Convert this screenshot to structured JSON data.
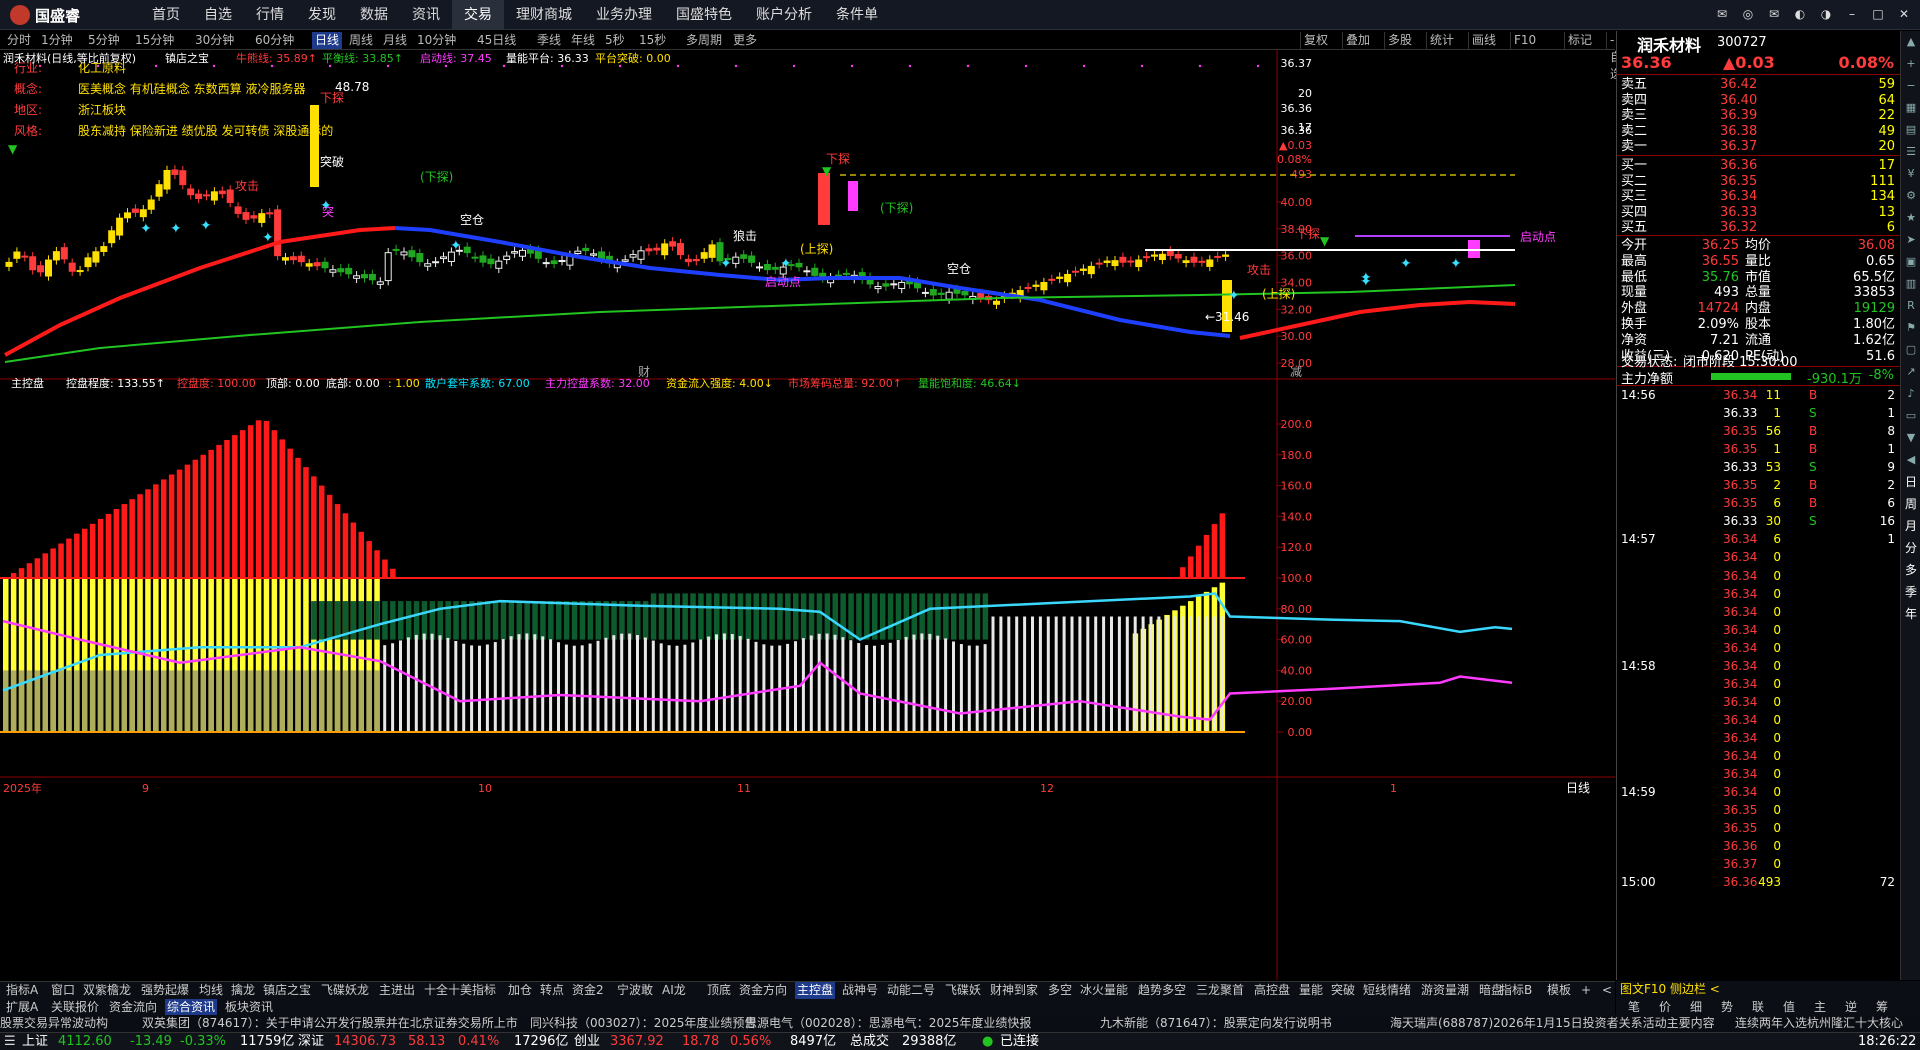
{
  "top": {
    "logo": "国盛睿",
    "menu": [
      "首页",
      "自选",
      "行情",
      "发现",
      "数据",
      "资讯",
      "交易",
      "理财商城",
      "业务办理",
      "国盛特色",
      "账户分析",
      "条件单"
    ],
    "active": "交易"
  },
  "periods": {
    "items": [
      "分时",
      "1分钟",
      "5分钟",
      "15分钟",
      "30分钟",
      "60分钟",
      "日线",
      "周线",
      "月线",
      "10分钟",
      "45日线",
      "季线",
      "年线",
      "5秒",
      "15秒",
      "多周期",
      "更多"
    ],
    "active": "日线",
    "right": [
      "复权",
      "叠加",
      "多股",
      "统计",
      "画线",
      "F10",
      "标记",
      "-自选",
      "返回"
    ]
  },
  "kline": {
    "title": "润禾材料(日线,等比前复权)",
    "indname": "镇店之宝",
    "niuxiong_label": "牛熊线: 35.89↑",
    "pingheng_label": "平衡线: 33.85↑",
    "qidong_label": "启动线: 37.45",
    "liangneng_label": "量能平台: 36.33",
    "tupo_label": "平台突破: 0.00",
    "ylabels": [
      "40.00",
      "38.00",
      "36.00",
      "34.00",
      "32.00",
      "30.00",
      "28.00"
    ],
    "ytop": [
      "36.37",
      "20",
      "36.36",
      "17",
      "36.36",
      "▲0.03",
      "0.08%",
      "493"
    ],
    "info_keys": [
      "行业:",
      "概念:",
      "地区:",
      "风格:"
    ],
    "info_vals": [
      "化工原料",
      "医美概念 有机硅概念 东数西算 液冷服务器",
      "浙江板块",
      "股东减持 保险新进 绩优股 发可转债 深股通标的"
    ],
    "marks": [
      "48.78",
      "下探",
      "突破",
      "攻击",
      "突",
      "(下探)",
      "空仓",
      "下探",
      "(上探)",
      "(下探)",
      "狼击",
      "启动点",
      "←31.46",
      "下探",
      "启动点",
      "攻击",
      "(上探)",
      "空仓",
      "财",
      "减"
    ]
  },
  "sub": {
    "name": "主控盘",
    "ctrl_label": "控盘程度: 133.55↑",
    "kongpan_label": "控盘度: 100.00",
    "ding_label": "顶部: 0.00",
    "di_label": "底部: 0.00",
    "ratio_label": ": 1.00",
    "sanhu_label": "散户套牢系数: 67.00",
    "zhuli_label": "主力控盘系数: 32.00",
    "zijin_label": "资金流入强度: 4.00↓",
    "shichang_label": "市场筹码总量: 92.00↑",
    "liang_label": "量能饱和度: 46.64↓",
    "ylabels": [
      "200.0",
      "180.0",
      "160.0",
      "140.0",
      "120.0",
      "100.0",
      "80.00",
      "60.00",
      "40.00",
      "20.00",
      "0.00"
    ]
  },
  "xaxis": {
    "labels": [
      "2025年",
      "9",
      "10",
      "11",
      "12",
      "1"
    ],
    "right": "日线"
  },
  "quote": {
    "name": "润禾材料",
    "code": "300727",
    "price": "36.36",
    "change": "▲0.03",
    "pct": "0.08%",
    "asks": [
      [
        "卖五",
        "36.42",
        "59"
      ],
      [
        "卖四",
        "36.40",
        "64"
      ],
      [
        "卖三",
        "36.39",
        "22"
      ],
      [
        "卖二",
        "36.38",
        "49"
      ],
      [
        "卖一",
        "36.37",
        "20"
      ]
    ],
    "bids": [
      [
        "买一",
        "36.36",
        "17"
      ],
      [
        "买二",
        "36.35",
        "111"
      ],
      [
        "买三",
        "36.34",
        "134"
      ],
      [
        "买四",
        "36.33",
        "13"
      ],
      [
        "买五",
        "36.32",
        "6"
      ]
    ],
    "stats": [
      [
        "今开",
        "36.25",
        "均价",
        "36.08"
      ],
      [
        "最高",
        "36.55",
        "量比",
        "0.65"
      ],
      [
        "最低",
        "35.76",
        "市值",
        "65.5亿"
      ],
      [
        "现量",
        "493",
        "总量",
        "33853"
      ],
      [
        "外盘",
        "14724",
        "内盘",
        "19129"
      ],
      [
        "换手",
        "2.09%",
        "股本",
        "1.80亿"
      ],
      [
        "净资",
        "7.21",
        "流通",
        "1.62亿"
      ],
      [
        "收益(三)",
        "0.620",
        "PE(动)",
        "51.6"
      ]
    ],
    "state_label": "交易状态:",
    "state": "闭市阶段 15:30:00",
    "net_label": "主力净额",
    "net": "-930.1万",
    "net_pct": "-8%",
    "ticks": [
      [
        "14:56",
        "36.34",
        "11",
        "B",
        "2"
      ],
      [
        "",
        "36.33",
        "1",
        "S",
        "1"
      ],
      [
        "",
        "36.35",
        "56",
        "B",
        "8"
      ],
      [
        "",
        "36.35",
        "1",
        "B",
        "1"
      ],
      [
        "",
        "36.33",
        "53",
        "S",
        "9"
      ],
      [
        "",
        "36.35",
        "2",
        "B",
        "2"
      ],
      [
        "",
        "36.35",
        "6",
        "B",
        "6"
      ],
      [
        "",
        "36.33",
        "30",
        "S",
        "16"
      ],
      [
        "14:57",
        "36.34",
        "6",
        "",
        "1"
      ],
      [
        "",
        "36.34",
        "0",
        "",
        ""
      ],
      [
        "",
        "36.34",
        "0",
        "",
        ""
      ],
      [
        "",
        "36.34",
        "0",
        "",
        ""
      ],
      [
        "",
        "36.34",
        "0",
        "",
        ""
      ],
      [
        "",
        "36.34",
        "0",
        "",
        ""
      ],
      [
        "",
        "36.34",
        "0",
        "",
        ""
      ],
      [
        "14:58",
        "36.34",
        "0",
        "",
        ""
      ],
      [
        "",
        "36.34",
        "0",
        "",
        ""
      ],
      [
        "",
        "36.34",
        "0",
        "",
        ""
      ],
      [
        "",
        "36.34",
        "0",
        "",
        ""
      ],
      [
        "",
        "36.34",
        "0",
        "",
        ""
      ],
      [
        "",
        "36.34",
        "0",
        "",
        ""
      ],
      [
        "",
        "36.34",
        "0",
        "",
        ""
      ],
      [
        "14:59",
        "36.34",
        "0",
        "",
        ""
      ],
      [
        "",
        "36.35",
        "0",
        "",
        ""
      ],
      [
        "",
        "36.35",
        "0",
        "",
        ""
      ],
      [
        "",
        "36.36",
        "0",
        "",
        ""
      ],
      [
        "",
        "36.37",
        "0",
        "",
        ""
      ],
      [
        "15:00",
        "36.36",
        "493",
        "",
        "72"
      ]
    ]
  },
  "side": [
    "日",
    "周",
    "月",
    "分",
    "多",
    "季",
    "年"
  ],
  "ind": {
    "items": [
      "指标A",
      "窗口",
      "双紫檐龙",
      "强势起爆",
      "均线",
      "擒龙",
      "镇店之宝",
      "飞碟妖龙",
      "主进出",
      "十全十美指标",
      "加仓",
      "转点",
      "资金2",
      "宁波敢",
      "AI龙",
      "顶底",
      "资金方向",
      "主控盘",
      "战神号",
      "动能二号",
      "飞碟妖",
      "财神到家",
      "多空",
      "冰火量能",
      "趋势多空",
      "三龙聚首",
      "高控盘",
      "量能",
      "突破",
      "短线情绪",
      "游资量潮",
      "暗盘"
    ],
    "active": "主控盘",
    "right": [
      "指标B",
      "模板",
      "+",
      "<",
      ">"
    ],
    "row2": [
      "扩展A",
      "关联报价",
      "资金流向",
      "综合资讯",
      "板块资讯"
    ],
    "row2_active": "综合资讯",
    "qtop": "图文F10 侧边栏 <",
    "qtabs": [
      "笔",
      "价",
      "细",
      "势",
      "联",
      "值",
      "主",
      "逆",
      "筹"
    ]
  },
  "news": [
    "股票交易异常波动构",
    "双英集团（874617）：关于申请公开发行股票并在北京证券交易所上市",
    "同兴科技（003027）：2025年度业绩预告",
    "思源电气（002028）：思源电气：2025年度业绩快报",
    "九木新能（871647）：股票定向发行说明书",
    "海天瑞声(688787)2026年1月15日投资者关系活动主要内容",
    "连续两年入选杭州隆汇十大核心"
  ],
  "status": {
    "sh_label": "上证",
    "sh": "4112.60",
    "sh_chg": "-13.49",
    "sh_pct": "-0.33%",
    "sh_amt": "11759亿",
    "sz_label": "深证",
    "sz": "14306.73",
    "sz_chg": "58.13",
    "sz_pct": "0.41%",
    "sz_amt": "17296亿",
    "cy_label": "创业",
    "cy": "3367.92",
    "cy_chg": "18.78",
    "cy_pct": "0.56%",
    "cy_amt": "8497亿",
    "total_label": "总成交",
    "total": "29388亿",
    "conn": "已连接",
    "time": "18:26:22"
  }
}
